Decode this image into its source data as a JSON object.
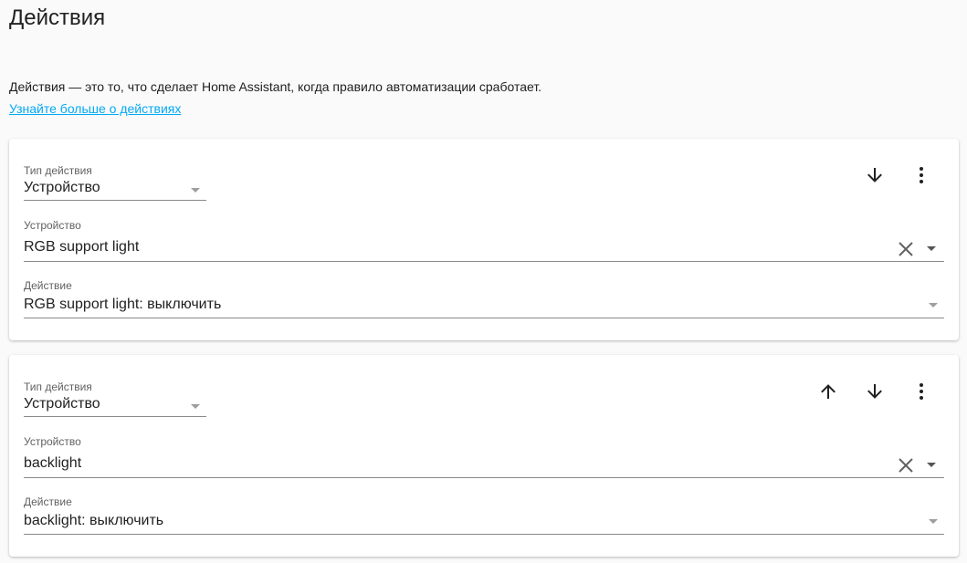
{
  "header": {
    "title": "Действия",
    "description": "Действия — это то, что сделает Home Assistant, когда правило автоматизации сработает.",
    "learn_more": "Узнайте больше о действиях"
  },
  "actions": [
    {
      "type_label": "Тип действия",
      "type_value": "Устройство",
      "device_label": "Устройство",
      "device_value": "RGB support light",
      "action_label": "Действие",
      "action_value": "RGB support light: выключить",
      "controls": [
        "arrow-down-icon",
        "more-vert-icon"
      ]
    },
    {
      "type_label": "Тип действия",
      "type_value": "Устройство",
      "device_label": "Устройство",
      "device_value": "backlight",
      "action_label": "Действие",
      "action_value": "backlight: выключить",
      "controls": [
        "arrow-up-icon",
        "arrow-down-icon",
        "more-vert-icon"
      ]
    }
  ],
  "colors": {
    "accent": "#03a9f4",
    "background": "#fafafa",
    "card": "#ffffff",
    "text": "#212121"
  }
}
